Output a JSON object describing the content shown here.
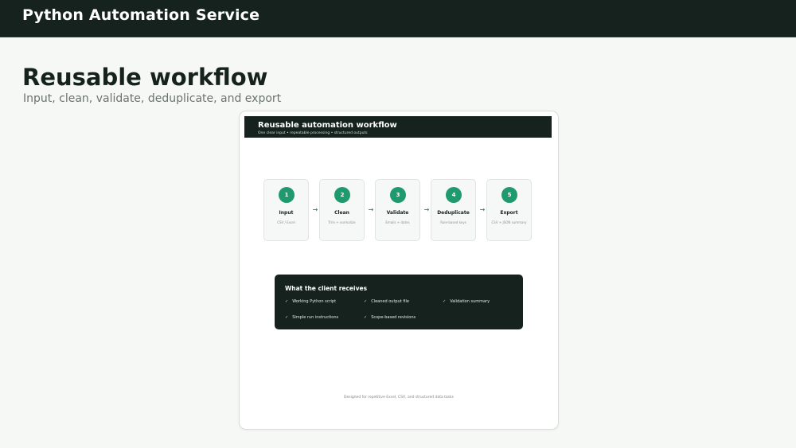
{
  "app": {
    "title": "Python Automation Service"
  },
  "page": {
    "heading": "Reusable workflow",
    "subtitle": "Input, clean, validate, deduplicate, and export"
  },
  "card": {
    "title": "Reusable automation workflow",
    "subtitle": "One clear input • repeatable processing • structured outputs",
    "steps": [
      {
        "number": "1",
        "name": "Input",
        "desc": "CSV / Excel"
      },
      {
        "number": "2",
        "name": "Clean",
        "desc": "Trim + normalize"
      },
      {
        "number": "3",
        "name": "Validate",
        "desc": "Emails + dates"
      },
      {
        "number": "4",
        "name": "Deduplicate",
        "desc": "Rule-based keys"
      },
      {
        "number": "5",
        "name": "Export",
        "desc": "CSV + JSON summary"
      }
    ],
    "arrow_glyph": "→",
    "receives": {
      "title": "What the client receives",
      "check_glyph": "✓",
      "items": [
        "Working Python script",
        "Cleaned output file",
        "Validation summary",
        "Simple run instructions",
        "Scope-based revisions"
      ]
    },
    "footnote": "Designed for repetitive Excel, CSV, and structured data tasks"
  },
  "colors": {
    "topbar": "#16221d",
    "accent": "#1f9a6e",
    "background": "#f6f8f6"
  }
}
